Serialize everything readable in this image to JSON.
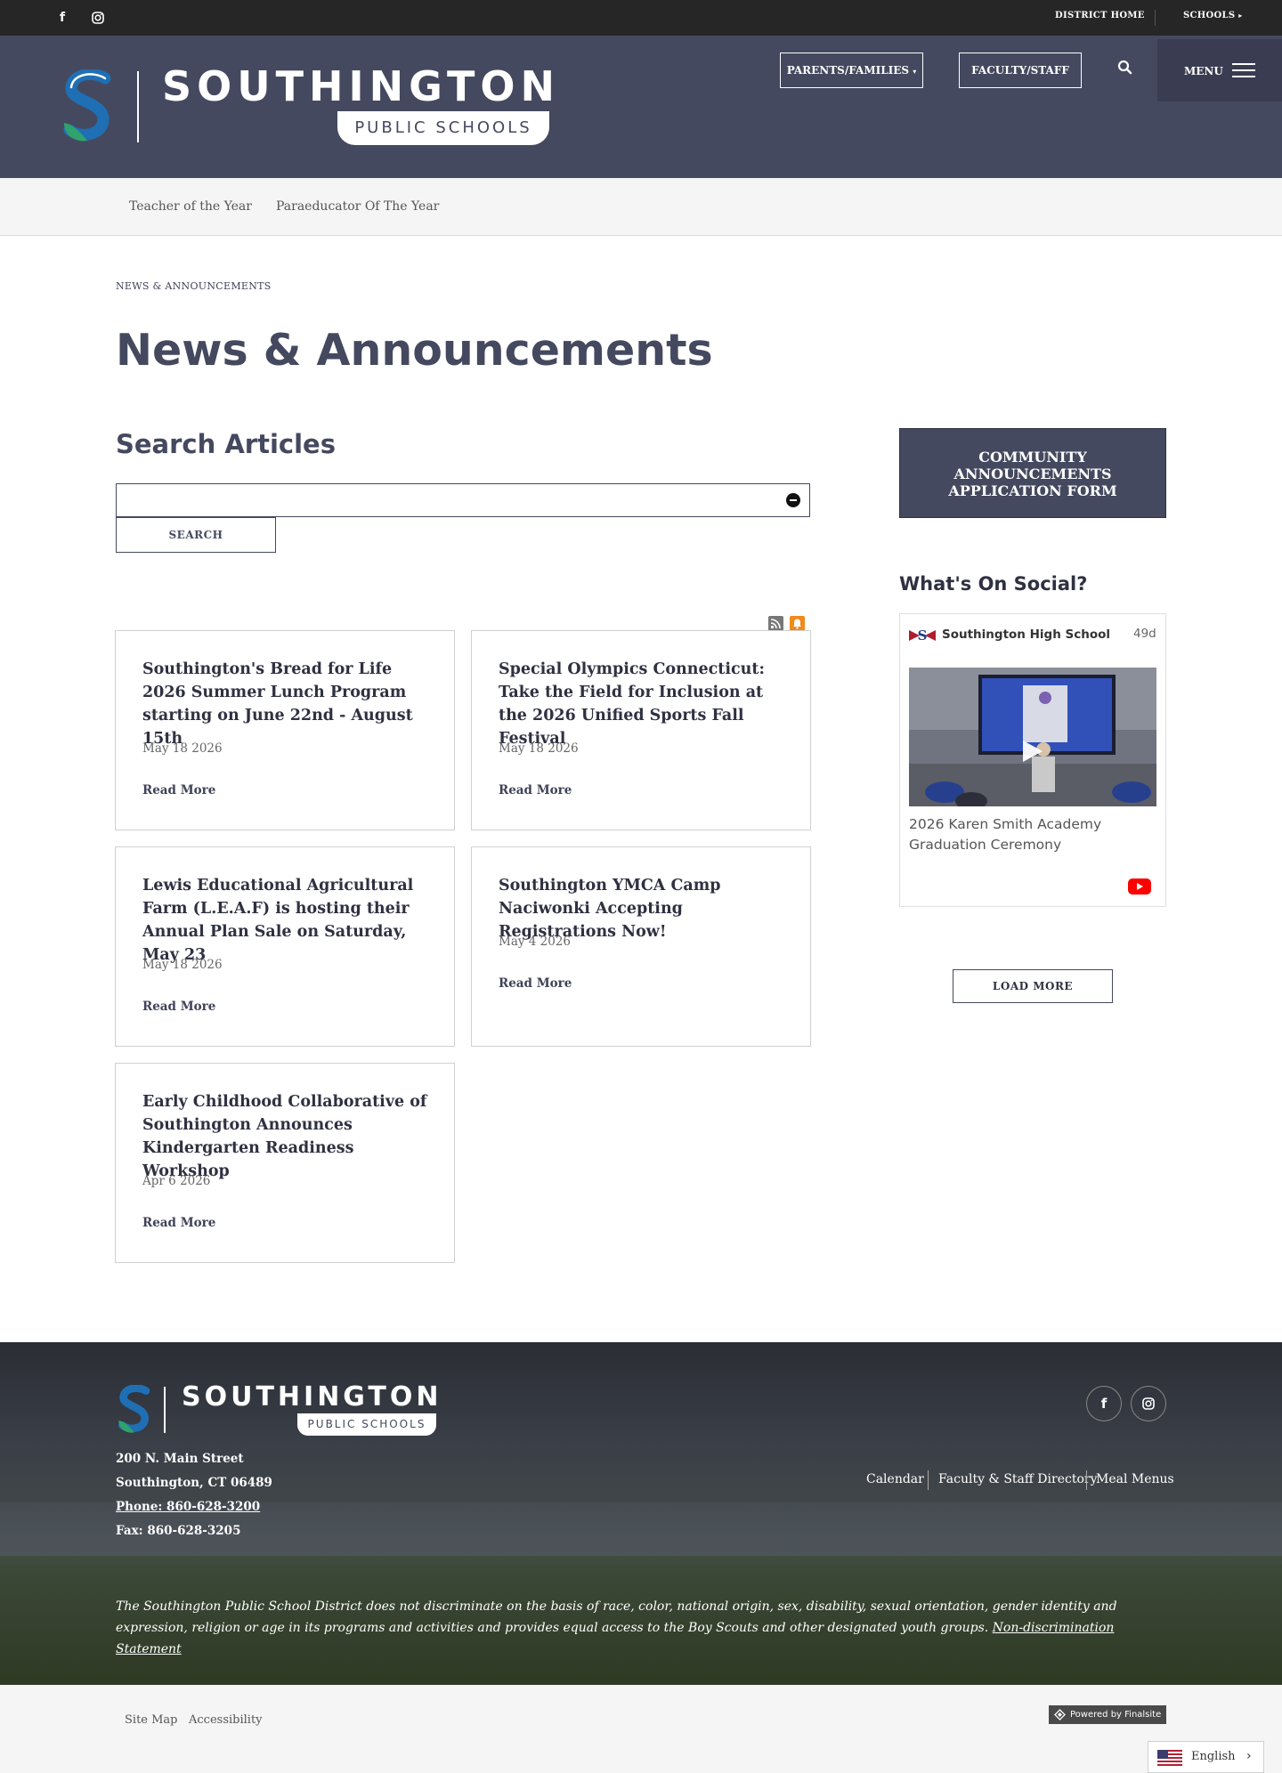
{
  "utility": {
    "facebook_glyph": "f",
    "district_home": "DISTRICT HOME",
    "schools": "SCHOOLS"
  },
  "header": {
    "logo_title": "SOUTHINGTON",
    "logo_sub": "PUBLIC SCHOOLS",
    "parents_label": "PARENTS/FAMILIES",
    "faculty_label": "FACULTY/STAFF",
    "menu_label": "MENU"
  },
  "subnav": {
    "items": [
      "Teacher of the Year",
      "Paraeducator Of The Year"
    ]
  },
  "main": {
    "breadcrumb": "NEWS & ANNOUNCEMENTS",
    "title": "News & Announcements",
    "search_heading": "Search Articles",
    "search_value": "",
    "search_button": "SEARCH",
    "read_more": "Read More",
    "articles": [
      {
        "title": "Southington's Bread for Life 2026 Summer Lunch Program starting on June 22nd - August 15th",
        "date": "May 18 2026"
      },
      {
        "title": "Special Olympics Connecticut: Take the Field for Inclusion at the 2026 Unified Sports Fall Festival",
        "date": "May 18 2026"
      },
      {
        "title": "Lewis Educational Agricultural Farm (L.E.A.F) is hosting their Annual Plan Sale on Saturday, May 23",
        "date": "May 18 2026"
      },
      {
        "title": "Southington YMCA Camp Naciwonki Accepting Registrations Now!",
        "date": "May 4 2026"
      },
      {
        "title": "Early Childhood Collaborative of Southington Announces Kindergarten Readiness Workshop",
        "date": "Apr 6 2026"
      }
    ]
  },
  "sidebar": {
    "community_button": "COMMUNITY ANNOUNCEMENTS APPLICATION FORM",
    "social_heading": "What's On Social?",
    "social_post": {
      "account": "Southington High School",
      "age": "49d",
      "caption": "2026 Karen Smith Academy Graduation Ceremony"
    },
    "load_more": "LOAD MORE"
  },
  "footer": {
    "logo_title": "SOUTHINGTON",
    "logo_sub": "PUBLIC SCHOOLS",
    "address_line1": "200 N. Main Street",
    "address_line2": "Southington, CT  06489",
    "phone": "Phone: 860-628-3200",
    "fax": "Fax: 860-628-3205",
    "facebook_glyph": "f",
    "links": [
      "Calendar",
      "Faculty & Staff Directory",
      "Meal Menus"
    ],
    "notice": "The Southington Public School District does not discriminate on the basis of race, color, national origin, sex, disability, sexual orientation, gender identity and expression, religion or age in its programs and activities and provides equal access to the Boy Scouts and other designated youth groups.",
    "notice_link": "Non-discrimination Statement"
  },
  "bottom": {
    "site_map": "Site Map",
    "accessibility": "Accessibility",
    "powered_by": "Powered by Finalsite",
    "language": "English",
    "chevron": "›"
  },
  "colors": {
    "brand_navy": "#45495f",
    "utility_bar": "#262626",
    "logo_blue": "#1f6fb5",
    "logo_green": "#2fa36b",
    "youtube_red": "#ff0000",
    "rss_gray": "#777777",
    "notify_orange": "#f08a1c"
  },
  "icons": {
    "facebook": "facebook-icon",
    "instagram": "instagram-icon",
    "search": "search-icon",
    "menu": "hamburger-icon",
    "clear": "minus-circle-icon",
    "rss": "rss-icon",
    "notify": "bell-icon",
    "play": "play-icon",
    "youtube": "youtube-icon",
    "flag": "us-flag-icon"
  }
}
